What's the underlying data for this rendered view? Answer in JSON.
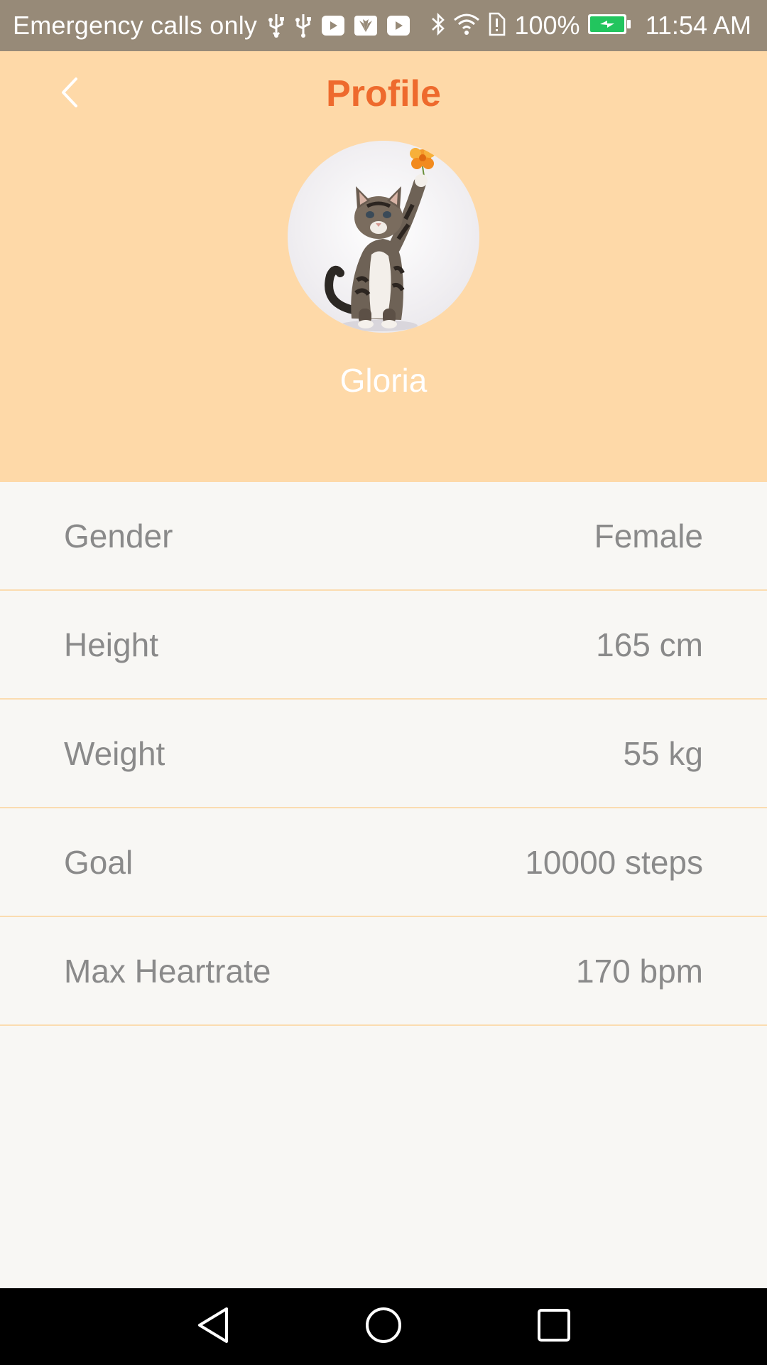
{
  "status_bar": {
    "carrier_text": "Emergency calls only",
    "battery_percent": "100%",
    "time": "11:54 AM",
    "icons": [
      "usb-icon",
      "usb-icon",
      "youtube-icon",
      "huawei-icon",
      "youtube-icon",
      "bluetooth-icon",
      "wifi-icon",
      "sim-alert-icon",
      "battery-charging-icon"
    ],
    "battery_color": "#22c55e"
  },
  "header": {
    "title": "Profile",
    "back_icon": "chevron-left-icon",
    "username": "Gloria",
    "background_color": "#fed9a8",
    "title_color": "#ee6a2d"
  },
  "profile_rows": [
    {
      "label": "Gender",
      "value": "Female"
    },
    {
      "label": "Height",
      "value": "165 cm"
    },
    {
      "label": "Weight",
      "value": "55 kg"
    },
    {
      "label": "Goal",
      "value": "10000 steps"
    },
    {
      "label": "Max Heartrate",
      "value": "170 bpm"
    }
  ],
  "nav_bar": {
    "buttons": [
      "back-triangle-icon",
      "home-circle-icon",
      "recents-square-icon"
    ]
  }
}
